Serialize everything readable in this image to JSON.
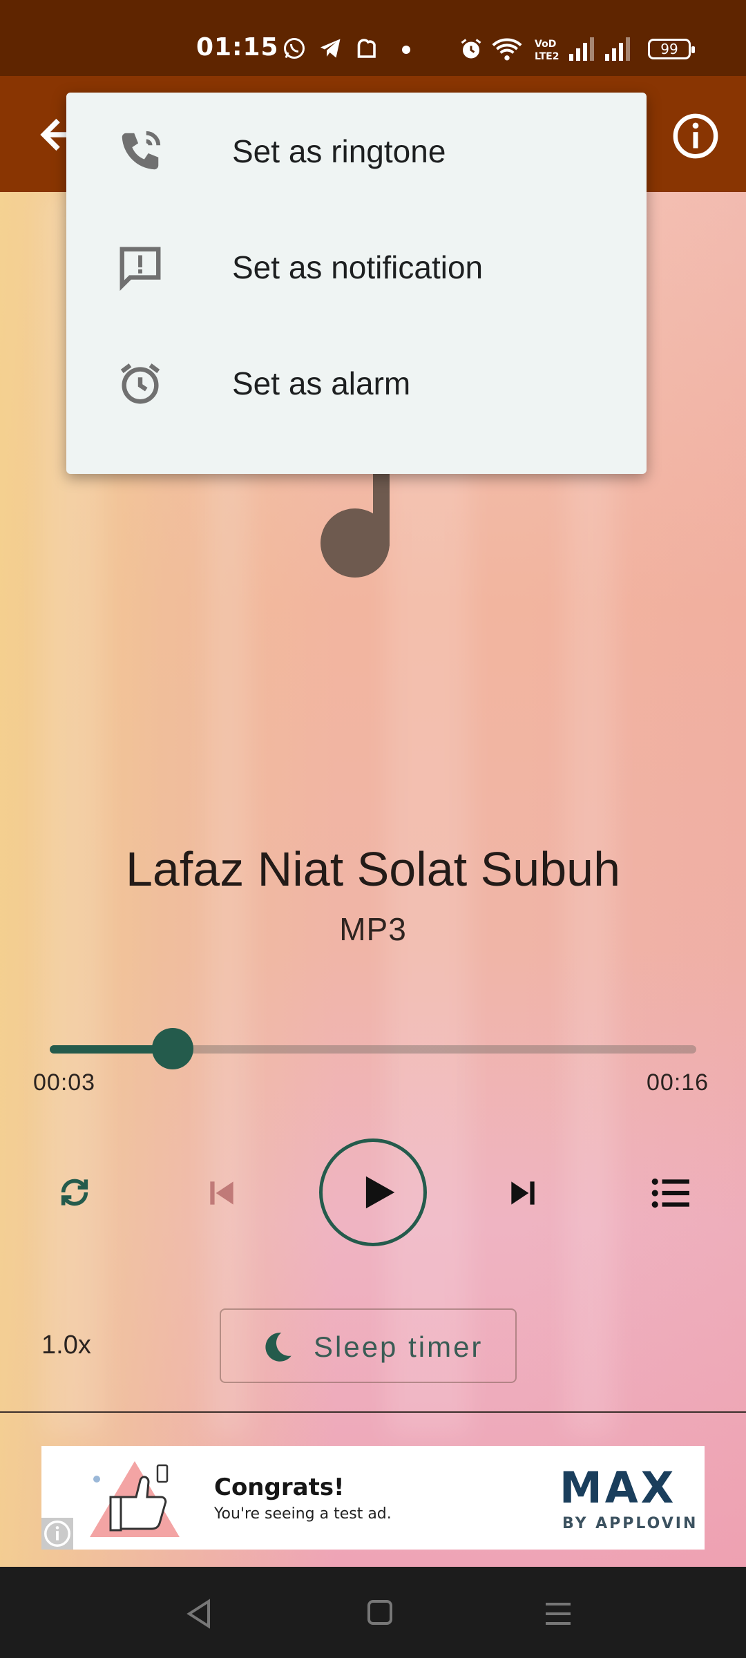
{
  "status_bar": {
    "time": "01:15",
    "battery": "99",
    "icons": [
      "whatsapp-icon",
      "telegram-icon",
      "notification-icon",
      "dot-icon",
      "alarm-icon",
      "wifi-icon",
      "volte-icon",
      "signal-icon",
      "signal-icon"
    ]
  },
  "app_bar": {
    "icons": [
      "back-arrow-icon",
      "info-icon"
    ]
  },
  "menu": {
    "items": [
      {
        "label": "Set as ringtone",
        "icon": "ringtone-phone-icon"
      },
      {
        "label": "Set as notification",
        "icon": "notification-message-icon"
      },
      {
        "label": "Set as alarm",
        "icon": "alarm-clock-icon"
      }
    ]
  },
  "player": {
    "title": "Lafaz Niat Solat Subuh",
    "format": "MP3",
    "elapsed": "00:03",
    "duration": "00:16",
    "progress": 0.19,
    "speed": "1.0x",
    "sleep_timer_label": "Sleep timer",
    "colors": {
      "accent": "#245b4c",
      "app_bar": "#893502",
      "status_bar": "#5f2500"
    }
  },
  "ad": {
    "title": "Congrats!",
    "subtitle": "You're seeing a test ad.",
    "brand": "MAX",
    "brand_sub": "BY APPLOVIN"
  }
}
